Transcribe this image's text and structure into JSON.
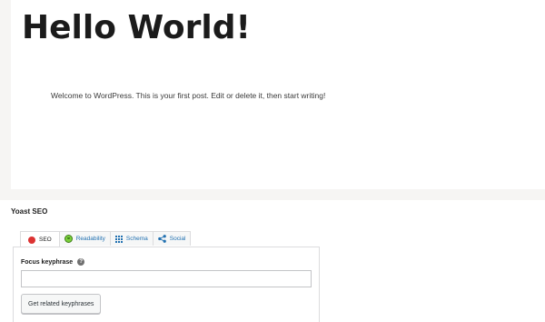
{
  "post": {
    "title": "Hello World!",
    "body": "Welcome to WordPress. This is your first post. Edit or delete it, then start writing!"
  },
  "yoast": {
    "title": "Yoast SEO",
    "tabs": [
      {
        "label": "SEO",
        "icon": "red-dot-icon",
        "active": true
      },
      {
        "label": "Readability",
        "icon": "green-smiley-icon",
        "active": false
      },
      {
        "label": "Schema",
        "icon": "grid-icon",
        "active": false
      },
      {
        "label": "Social",
        "icon": "share-icon",
        "active": false
      }
    ],
    "focus_label": "Focus keyphrase",
    "focus_value": "",
    "focus_placeholder": "",
    "related_button": "Get related keyphrases"
  },
  "colors": {
    "seo_status": "#dc3232",
    "readability_status": "#7ad03a",
    "link_blue": "#2271b1"
  }
}
